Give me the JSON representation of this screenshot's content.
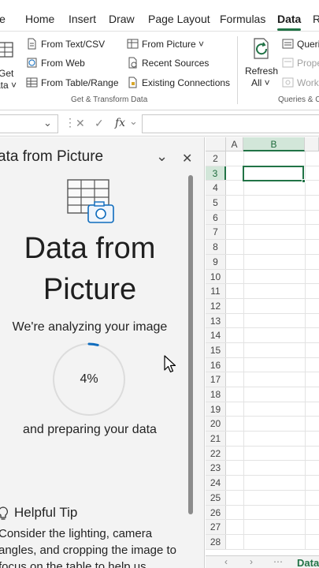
{
  "ribbon_tabs": [
    "le",
    "Home",
    "Insert",
    "Draw",
    "Page Layout",
    "Formulas",
    "Data",
    "R"
  ],
  "active_tab": "Data",
  "ribbon": {
    "get_data": {
      "line1": "Get",
      "line2": "ata ˅"
    },
    "from_text_csv": "From Text/CSV",
    "from_web": "From Web",
    "from_table_range": "From Table/Range",
    "from_picture": "From Picture ˅",
    "recent_sources": "Recent Sources",
    "existing_connections": "Existing Connections",
    "refresh_all": {
      "line1": "Refresh",
      "line2": "All ˅"
    },
    "queries": "Queri",
    "properties": "Prope",
    "workbook_links": "Work",
    "group_get_transform": "Get & Transform Data",
    "group_queries": "Queries & C"
  },
  "formula_bar": {
    "cancel": "✕",
    "enter": "✓",
    "fx": "fx",
    "value": ""
  },
  "pane": {
    "title": "ata from Picture",
    "heading_line1": "Data from",
    "heading_line2": "Picture",
    "analyzing": "We're analyzing your image",
    "progress": 0.04,
    "progress_text": "4%",
    "preparing": "and preparing your data",
    "tip_title": "Helpful Tip",
    "tip_body": "Consider the lighting, camera angles, and cropping the image to focus on the table to help us"
  },
  "grid": {
    "columns": [
      "A",
      "B"
    ],
    "selected_column": "B",
    "rows": [
      "2",
      "3",
      "4",
      "5",
      "6",
      "7",
      "8",
      "9",
      "10",
      "11",
      "12",
      "13",
      "14",
      "15",
      "16",
      "17",
      "18",
      "19",
      "20",
      "21",
      "22",
      "23",
      "24",
      "25",
      "26",
      "27",
      "28"
    ],
    "selected_row": "3",
    "active_cell": "B3"
  },
  "sheet_tab": "Data",
  "colors": {
    "excel_green": "#217346",
    "progress_blue": "#0f6cbd",
    "pane_bg": "#f3f3f3"
  }
}
